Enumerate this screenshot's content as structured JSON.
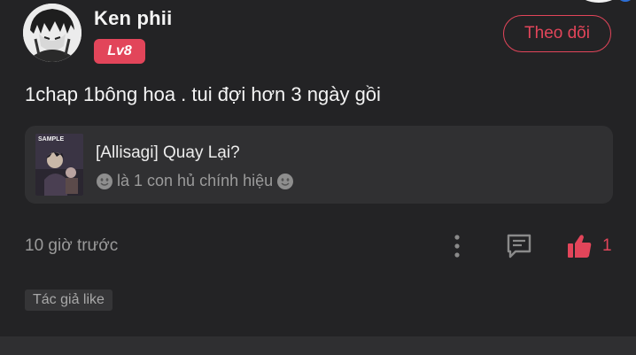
{
  "comment": {
    "user": {
      "name": "Ken phii",
      "level": "Lv8"
    },
    "follow_label": "Theo dõi",
    "text": "1chap 1bông hoa . tui đợi hơn 3 ngày gồi",
    "reference": {
      "title": "[Allisagi] Quay Lại?",
      "subtitle": "là 1 con hủ chính hiệu",
      "thumbnail_text": "SAMPLE"
    },
    "time": "10 giờ trước",
    "like_count": "1",
    "author_like_tag": "Tác giả like"
  },
  "colors": {
    "background": "#232325",
    "accent": "#e2455a",
    "card": "#303032",
    "muted_text": "#9a9a9a"
  },
  "icons": {
    "more": "vertical-dots-icon",
    "reply": "chat-bubble-icon",
    "like": "thumbs-up-icon",
    "emoji": "smiley-emoji-icon"
  }
}
